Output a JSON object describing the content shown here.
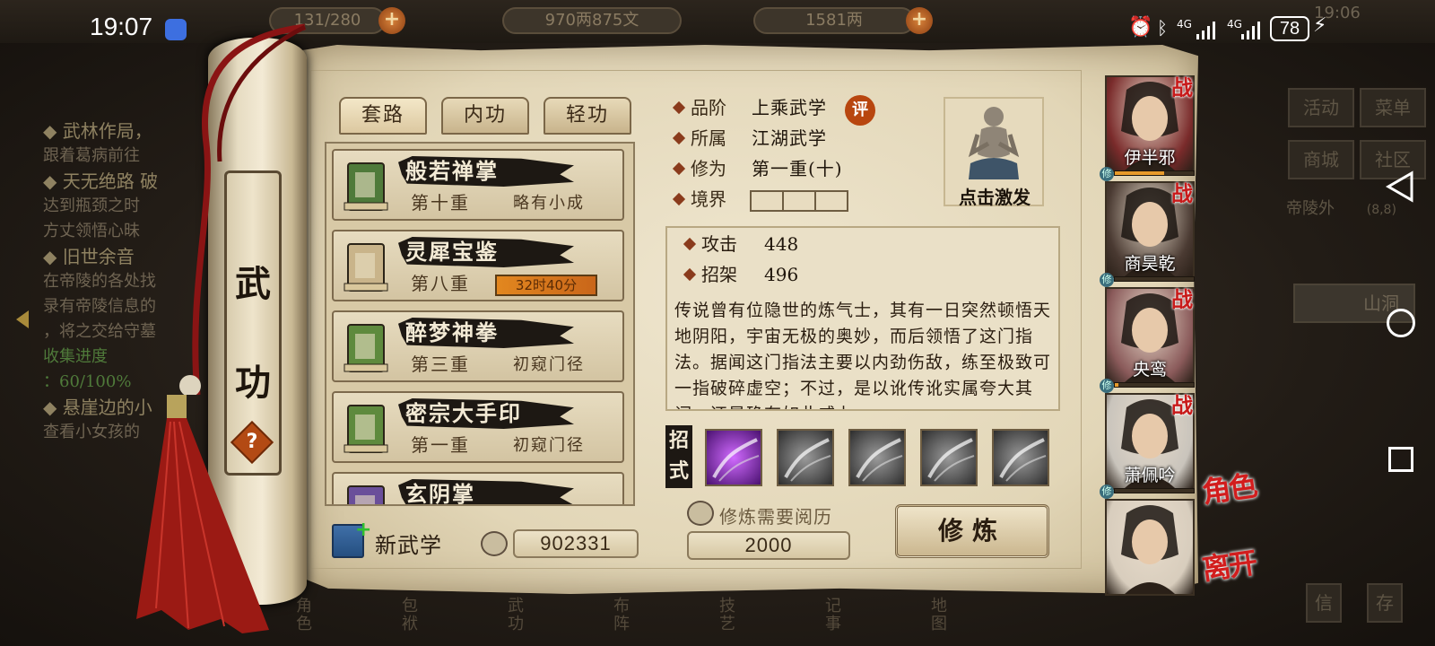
{
  "status_bar": {
    "time": "19:07",
    "net1": "4G",
    "net2": "4G",
    "battery": "78"
  },
  "background": {
    "resource1": "131/280",
    "resource2": "970两875文",
    "resource3": "1581两",
    "clock": "19:06",
    "log": [
      {
        "text": "◆ 武林作局，",
        "cls": "hd"
      },
      {
        "text": "跟着葛病前往",
        "cls": ""
      },
      {
        "text": "◆ 天无绝路 破",
        "cls": "hd"
      },
      {
        "text": "达到瓶颈之时",
        "cls": ""
      },
      {
        "text": "方丈领悟心昧",
        "cls": ""
      },
      {
        "text": "◆ 旧世余音",
        "cls": "hd"
      },
      {
        "text": "在帝陵的各处找",
        "cls": ""
      },
      {
        "text": "录有帝陵信息的",
        "cls": ""
      },
      {
        "text": "，将之交给守墓",
        "cls": ""
      },
      {
        "text": "收集进度",
        "cls": "green"
      },
      {
        "text": "：60/100%",
        "cls": "green"
      },
      {
        "text": "◆ 悬崖边的小",
        "cls": "hd"
      },
      {
        "text": "查看小女孩的",
        "cls": ""
      }
    ],
    "right_menu": [
      "活动",
      "菜单",
      "商城",
      "社区"
    ],
    "location": "帝陵外",
    "location_coords": "(8,8)",
    "room": "山洞",
    "bottom_nav": [
      "角色",
      "包袱",
      "武功",
      "布阵",
      "技艺",
      "记事",
      "地图"
    ],
    "bottom_right": [
      "信",
      "存"
    ]
  },
  "scroll": {
    "title_top": "武",
    "title_bottom": "功",
    "help": "?"
  },
  "tabs": [
    "套路",
    "内功",
    "轻功"
  ],
  "skills": [
    {
      "name": "般若禅掌",
      "level": "第十重",
      "state": "略有小成",
      "timer": null,
      "book": "#4f7a3a"
    },
    {
      "name": "灵犀宝鉴",
      "level": "第八重",
      "state": null,
      "timer": "32时40分",
      "book": "#c9b48a"
    },
    {
      "name": "醉梦神拳",
      "level": "第三重",
      "state": "初窥门径",
      "timer": null,
      "book": "#5e8a3d"
    },
    {
      "name": "密宗大手印",
      "level": "第一重",
      "state": "初窥门径",
      "timer": null,
      "book": "#5e8a3d"
    },
    {
      "name": "玄阴掌",
      "level": "",
      "state": "",
      "timer": null,
      "book": "#6a4f9a"
    }
  ],
  "footer": {
    "new_skill": "新武学",
    "points": "902331",
    "req_label": "修炼需要阅历",
    "req_value": "2000",
    "train_button": "修炼"
  },
  "detail": {
    "grade_label": "品阶",
    "grade_value": "上乘武学",
    "grade_badge": "评",
    "faction_label": "所属",
    "faction_value": "江湖武学",
    "cultivation_label": "修为",
    "cultivation_value": "第一重(十)",
    "realm_label": "境界",
    "activate_label": "点击激发",
    "attack_label": "攻击",
    "attack_value": "448",
    "parry_label": "招架",
    "parry_value": "496",
    "description": "传说曾有位隐世的炼气士，其有一日突然顿悟天地阴阳，宇宙无极的奥妙，而后领悟了这门指法。据闻这门指法主要以内劲伤敌，练至极致可一指破碎虚空；不过，是以讹传讹实属夸大其词，还是确有如此威力",
    "moves_label_1": "招",
    "moves_label_2": "式",
    "moves": [
      "purple",
      "gray",
      "gray",
      "gray",
      "gray"
    ]
  },
  "party": [
    {
      "name": "伊半邪",
      "bar": 0.62,
      "color": "#7a2b2b"
    },
    {
      "name": "商昊乾",
      "bar": 0.0,
      "color": "#4a3a32"
    },
    {
      "name": "央鸾",
      "bar": 0.05,
      "color": "#8a5a5a"
    },
    {
      "name": "萧佩吟",
      "bar": 0.0,
      "color": "#c9c4bc"
    },
    {
      "name": "",
      "bar": 0.0,
      "color": "#d8cdbd"
    }
  ],
  "party_badge": "战",
  "party_xiu": "修",
  "side_links": {
    "character": "角色",
    "leave": "离开"
  }
}
